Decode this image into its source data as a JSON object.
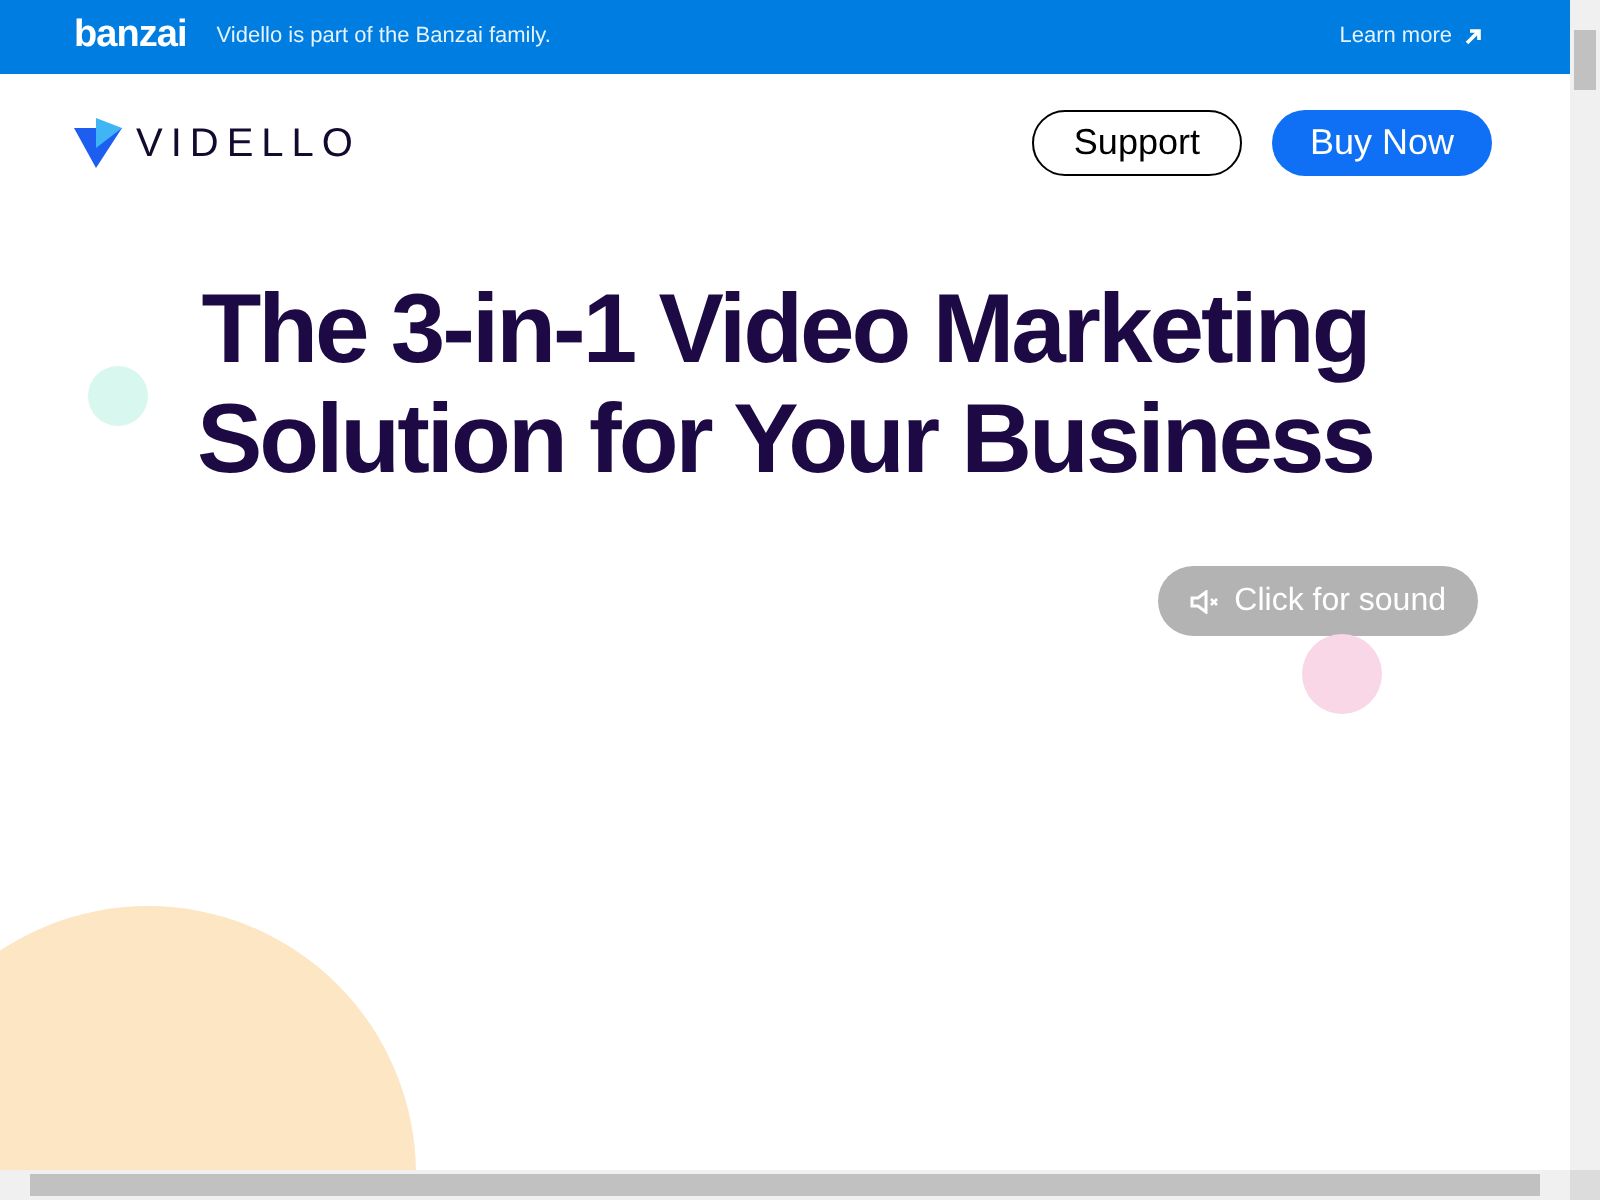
{
  "banner": {
    "brand": "banzai",
    "text": "Vidello is part of the Banzai family.",
    "link": "Learn more"
  },
  "header": {
    "logo": "VIDELLO",
    "buttons": [
      {
        "label": "Support",
        "kind": "outline"
      },
      {
        "label": "Buy Now",
        "kind": "primary"
      }
    ]
  },
  "hero": {
    "headline": "The 3-in-1 Video Marketing Solution for Your Business",
    "sound_button": "Click for sound"
  }
}
